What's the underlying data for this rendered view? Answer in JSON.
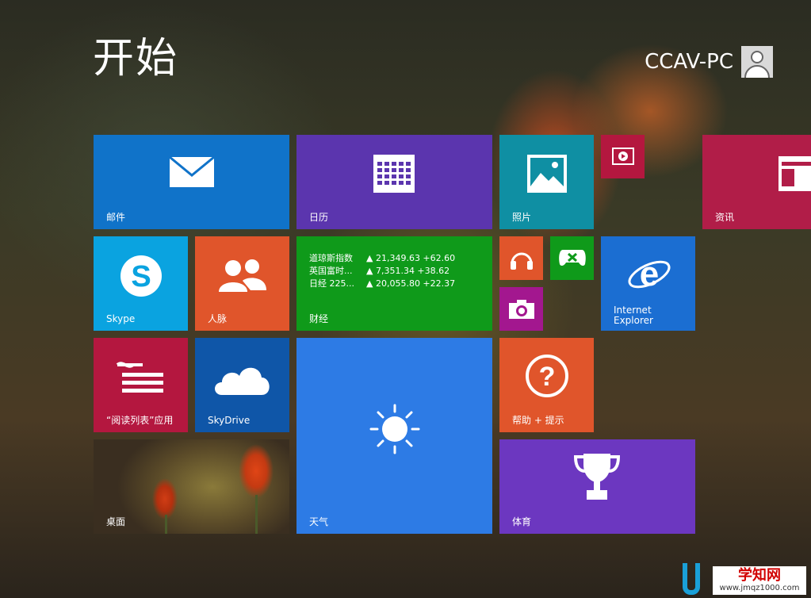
{
  "screen": {
    "title": "开始"
  },
  "user": {
    "name": "CCAV-PC",
    "avatar_icon": "user-silhouette-icon"
  },
  "tiles": {
    "mail": {
      "label": "邮件",
      "icon": "envelope-icon",
      "color": "#1073c9"
    },
    "calendar": {
      "label": "日历",
      "icon": "calendar-icon",
      "color": "#5b35ae"
    },
    "photos": {
      "label": "照片",
      "icon": "picture-icon",
      "color": "#0f8fa3"
    },
    "video": {
      "label": "",
      "icon": "video-play-icon",
      "color": "#b4173f"
    },
    "news": {
      "label": "资讯",
      "icon": "newspaper-icon",
      "color": "#b11d48"
    },
    "skype": {
      "label": "Skype",
      "icon": "skype-icon",
      "color": "#0aa3e0"
    },
    "people": {
      "label": "人脉",
      "icon": "people-icon",
      "color": "#e0552b"
    },
    "finance": {
      "label": "财经",
      "color": "#0f9a1a",
      "quotes": [
        {
          "name": "道琼斯指数",
          "value": "▲ 21,349.63 +62.60"
        },
        {
          "name": "英国富时...",
          "value": "▲ 7,351.34 +38.62"
        },
        {
          "name": "日经 225...",
          "value": "▲ 20,055.80 +22.37"
        }
      ]
    },
    "music": {
      "label": "",
      "icon": "headphones-icon",
      "color": "#e0552b"
    },
    "games": {
      "label": "",
      "icon": "game-controller-icon",
      "color": "#0f9a1a"
    },
    "camera": {
      "label": "",
      "icon": "camera-icon",
      "color": "#a3178f"
    },
    "ie": {
      "label_line1": "Internet",
      "label_line2": "Explorer",
      "icon": "internet-explorer-icon",
      "color": "#1b6ed2"
    },
    "reading": {
      "label": "“阅读列表”应用",
      "icon": "reading-list-icon",
      "color": "#b4173f"
    },
    "skydrive": {
      "label": "SkyDrive",
      "icon": "cloud-icon",
      "color": "#0f56a8"
    },
    "weather": {
      "label": "天气",
      "icon": "sun-icon",
      "color": "#2d7be5"
    },
    "help": {
      "label": "帮助 + 提示",
      "icon": "question-mark-icon",
      "color": "#e0552b"
    },
    "desktop": {
      "label": "桌面"
    },
    "sports": {
      "label": "体育",
      "icon": "trophy-icon",
      "color": "#6c37c0"
    }
  },
  "watermark": {
    "title": "学知网",
    "url": "www.jmqz1000.com"
  }
}
